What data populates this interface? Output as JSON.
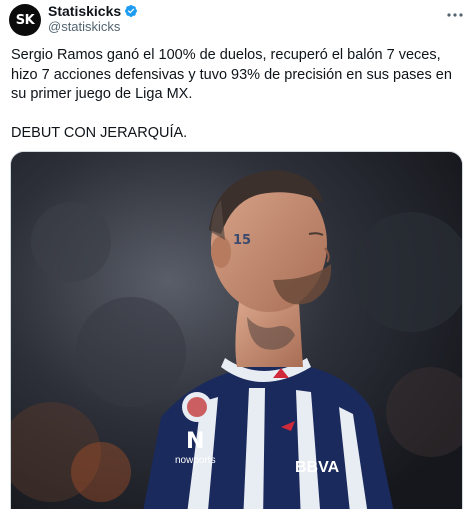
{
  "author": {
    "avatar_text": "SK",
    "display_name": "Statiskicks",
    "handle": "@statiskicks",
    "verified": true
  },
  "tweet": {
    "text": "Sergio Ramos ganó el 100% de duelos, recuperó el balón 7 veces, hizo 7 acciones defensivas y tuvo 93% de precisión en sus pases en su primer juego de Liga MX.\n\nDEBUT CON JERARQUÍA."
  },
  "media": {
    "alt": "photo",
    "jersey_texts": [
      "nowports",
      "PUMA",
      "BBVA",
      "15"
    ]
  },
  "colors": {
    "accent": "#1d9bf0",
    "text": "#0f1419",
    "muted": "#536471"
  },
  "icons": {
    "verified": "verified-badge-icon",
    "more": "more-options-icon"
  }
}
